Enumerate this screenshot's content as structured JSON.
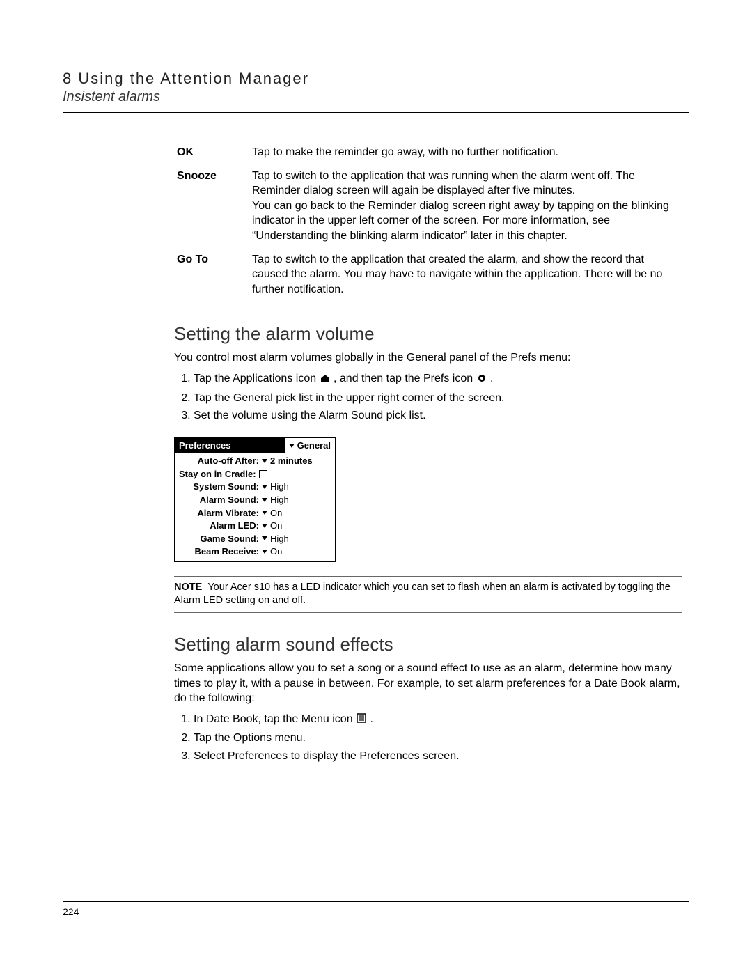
{
  "header": {
    "chapter": "8 Using the Attention Manager",
    "subchapter": "Insistent alarms"
  },
  "definitions": [
    {
      "term": "OK",
      "desc": "Tap to make the reminder go away, with no further notification."
    },
    {
      "term": "Snooze",
      "desc": "Tap to switch to the application that was running when the alarm went off. The Reminder dialog screen will again be displayed after five minutes.\nYou can go back to the Reminder dialog screen right away by tapping on the blinking indicator in the upper left corner of the screen. For more information, see “Understanding the blinking alarm indicator” later in this chapter."
    },
    {
      "term": "Go To",
      "desc": "Tap to switch to the application that created the alarm, and show the record that caused the alarm. You may have to navigate within the application. There will be no further notification."
    }
  ],
  "section1": {
    "title": "Setting the alarm volume",
    "intro": "You control most alarm volumes globally in the General panel of the Prefs menu:",
    "step1a": "Tap the Applications icon ",
    "step1b": ", and then tap the Prefs icon ",
    "step1c": ".",
    "step2": "Tap the General pick list in the upper right corner of the screen.",
    "step3": "Set the volume using the Alarm Sound pick list."
  },
  "prefs": {
    "title": "Preferences",
    "dropdown": "General",
    "rows": [
      {
        "label": "Auto-off After:",
        "value": "2 minutes",
        "type": "tri"
      },
      {
        "label": "Stay on in Cradle:",
        "value": "",
        "type": "check"
      },
      {
        "label": "System Sound:",
        "value": "High",
        "type": "tri"
      },
      {
        "label": "Alarm Sound:",
        "value": "High",
        "type": "tri"
      },
      {
        "label": "Alarm Vibrate:",
        "value": "On",
        "type": "tri"
      },
      {
        "label": "Alarm LED:",
        "value": "On",
        "type": "tri"
      },
      {
        "label": "Game Sound:",
        "value": "High",
        "type": "tri"
      },
      {
        "label": "Beam Receive:",
        "value": "On",
        "type": "tri"
      }
    ]
  },
  "note": {
    "label": "NOTE",
    "text": "Your Acer s10 has a LED indicator which you can set to flash when an alarm is activated by toggling the Alarm LED setting on and off."
  },
  "section2": {
    "title": "Setting alarm sound effects",
    "intro": "Some applications allow you to set a song or a sound effect to use as an alarm, determine how many times to play it, with a pause in between. For example, to set alarm preferences for a Date Book alarm, do the following:",
    "step1a": "In Date Book, tap the Menu icon ",
    "step1b": ".",
    "step2": "Tap the Options menu.",
    "step3": "Select Preferences to display the Preferences screen."
  },
  "page_number": "224"
}
